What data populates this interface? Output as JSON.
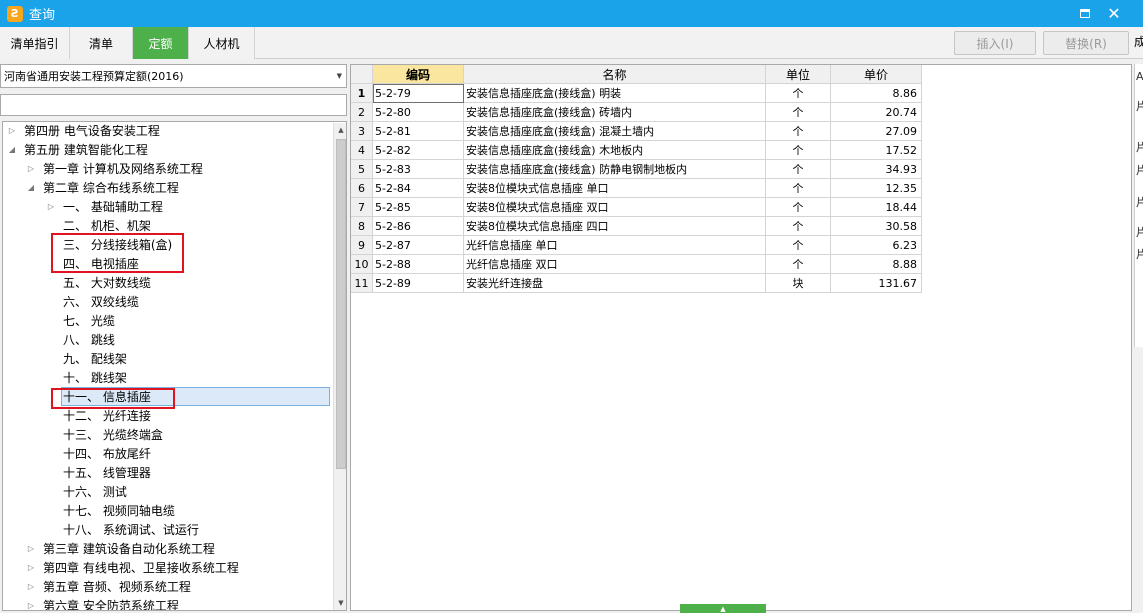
{
  "window": {
    "title": "查询",
    "app_icon_glyph": "Ƨ",
    "accent": "#1aa3e8",
    "tab_active_color": "#4db04a"
  },
  "tabs": [
    {
      "label": "清单指引"
    },
    {
      "label": "清单"
    },
    {
      "label": "定额",
      "active": true
    },
    {
      "label": "人材机"
    }
  ],
  "actions": {
    "insert_label": "插入(I)",
    "replace_label": "替换(R)"
  },
  "edge_text": "成",
  "library": {
    "selected": "河南省通用安装工程预算定额(2016)"
  },
  "filter": {
    "value": ""
  },
  "tree": [
    {
      "label": "第四册 电气设备安装工程",
      "level": 0,
      "toggle": "collapsed"
    },
    {
      "label": "第五册 建筑智能化工程",
      "level": 0,
      "toggle": "expanded"
    },
    {
      "label": "第一章 计算机及网络系统工程",
      "level": 1,
      "toggle": "collapsed"
    },
    {
      "label": "第二章 综合布线系统工程",
      "level": 1,
      "toggle": "expanded"
    },
    {
      "label": "一、 基础辅助工程",
      "level": 2,
      "toggle": "collapsed"
    },
    {
      "label": "二、 机柜、机架",
      "level": 2,
      "toggle": "none"
    },
    {
      "label": "三、 分线接线箱(盒)",
      "level": 2,
      "toggle": "none",
      "highlighted": true
    },
    {
      "label": "四、 电视插座",
      "level": 2,
      "toggle": "none",
      "highlighted": true
    },
    {
      "label": "五、 大对数线缆",
      "level": 2,
      "toggle": "none"
    },
    {
      "label": "六、 双绞线缆",
      "level": 2,
      "toggle": "none"
    },
    {
      "label": "七、 光缆",
      "level": 2,
      "toggle": "none"
    },
    {
      "label": "八、 跳线",
      "level": 2,
      "toggle": "none"
    },
    {
      "label": "九、 配线架",
      "level": 2,
      "toggle": "none"
    },
    {
      "label": "十、 跳线架",
      "level": 2,
      "toggle": "none"
    },
    {
      "label": "十一、 信息插座",
      "level": 2,
      "toggle": "none",
      "selected": true,
      "highlighted": true
    },
    {
      "label": "十二、 光纤连接",
      "level": 2,
      "toggle": "none"
    },
    {
      "label": "十三、 光缆终端盒",
      "level": 2,
      "toggle": "none"
    },
    {
      "label": "十四、 布放尾纤",
      "level": 2,
      "toggle": "none"
    },
    {
      "label": "十五、 线管理器",
      "level": 2,
      "toggle": "none"
    },
    {
      "label": "十六、 测试",
      "level": 2,
      "toggle": "none"
    },
    {
      "label": "十七、 视频同轴电缆",
      "level": 2,
      "toggle": "none"
    },
    {
      "label": "十八、 系统调试、试运行",
      "level": 2,
      "toggle": "none"
    },
    {
      "label": "第三章 建筑设备自动化系统工程",
      "level": 1,
      "toggle": "collapsed"
    },
    {
      "label": "第四章 有线电视、卫星接收系统工程",
      "level": 1,
      "toggle": "collapsed"
    },
    {
      "label": "第五章 音频、视频系统工程",
      "level": 1,
      "toggle": "collapsed"
    },
    {
      "label": "第六章 安全防范系统工程",
      "level": 1,
      "toggle": "collapsed"
    }
  ],
  "grid": {
    "columns": [
      "编码",
      "名称",
      "单位",
      "单价"
    ],
    "rows": [
      {
        "num": "1",
        "code": "5-2-79",
        "name": "安装信息插座底盒(接线盒) 明装",
        "unit": "个",
        "price": "8.86"
      },
      {
        "num": "2",
        "code": "5-2-80",
        "name": "安装信息插座底盒(接线盒) 砖墙内",
        "unit": "个",
        "price": "20.74"
      },
      {
        "num": "3",
        "code": "5-2-81",
        "name": "安装信息插座底盒(接线盒) 混凝土墙内",
        "unit": "个",
        "price": "27.09"
      },
      {
        "num": "4",
        "code": "5-2-82",
        "name": "安装信息插座底盒(接线盒) 木地板内",
        "unit": "个",
        "price": "17.52"
      },
      {
        "num": "5",
        "code": "5-2-83",
        "name": "安装信息插座底盒(接线盒) 防静电钢制地板内",
        "unit": "个",
        "price": "34.93"
      },
      {
        "num": "6",
        "code": "5-2-84",
        "name": "安装8位模块式信息插座 单口",
        "unit": "个",
        "price": "12.35"
      },
      {
        "num": "7",
        "code": "5-2-85",
        "name": "安装8位模块式信息插座 双口",
        "unit": "个",
        "price": "18.44"
      },
      {
        "num": "8",
        "code": "5-2-86",
        "name": "安装8位模块式信息插座 四口",
        "unit": "个",
        "price": "30.58"
      },
      {
        "num": "9",
        "code": "5-2-87",
        "name": "光纤信息插座 单口",
        "unit": "个",
        "price": "6.23"
      },
      {
        "num": "10",
        "code": "5-2-88",
        "name": "光纤信息插座 双口",
        "unit": "个",
        "price": "8.88"
      },
      {
        "num": "11",
        "code": "5-2-89",
        "name": "安装光纤连接盘",
        "unit": "块",
        "price": "131.67"
      }
    ]
  },
  "right_strip_glyphs": [
    "A",
    "片",
    "片",
    "片",
    "片",
    "片",
    "片"
  ]
}
